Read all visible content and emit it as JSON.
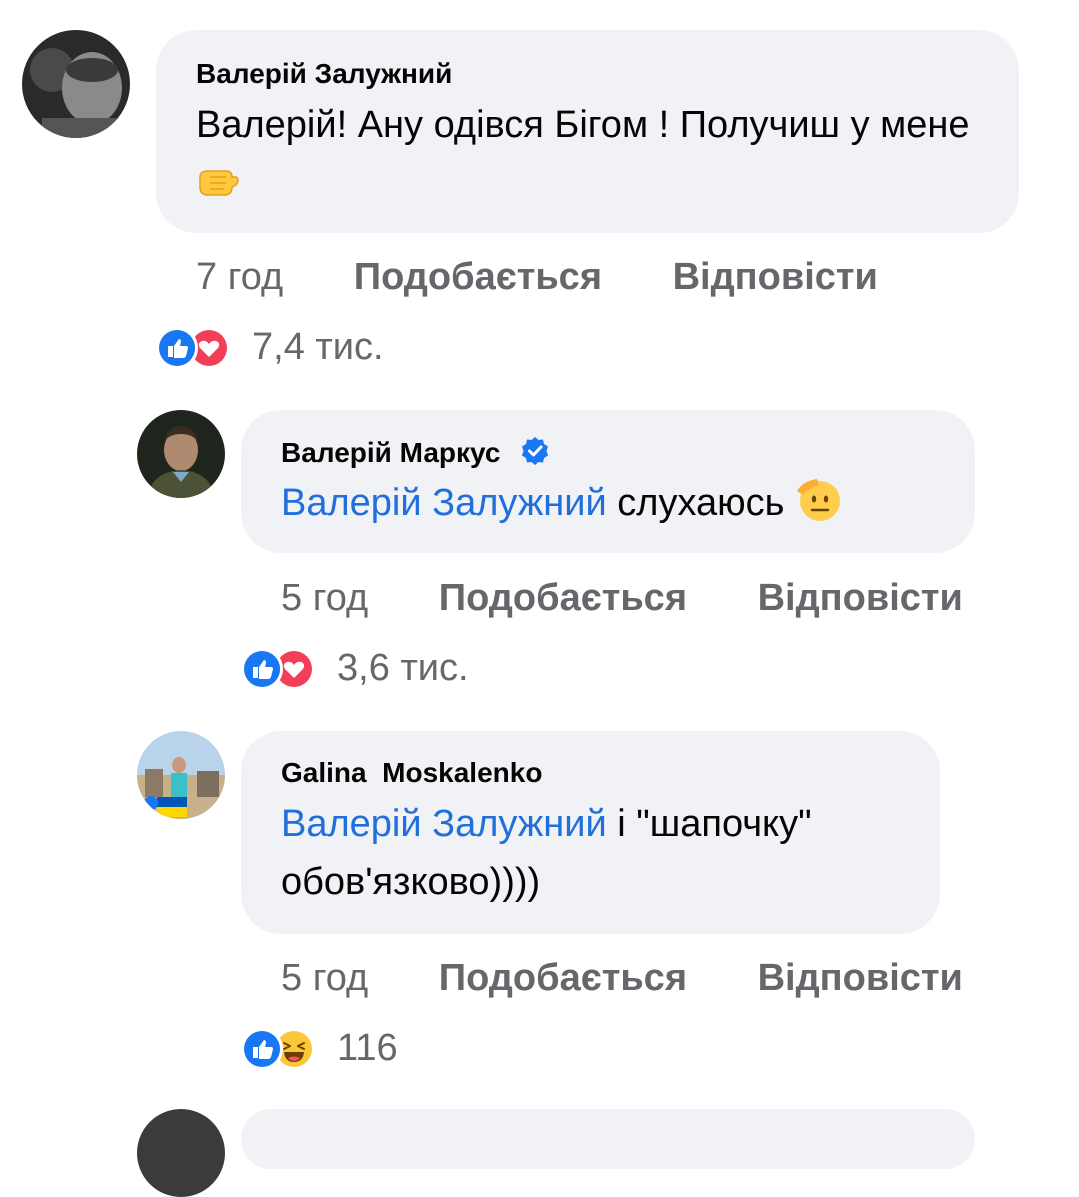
{
  "comments": [
    {
      "author": "Валерій Залужний",
      "text": "Валерій! Ану одівся Бігом ! Получиш у мене",
      "emoji": "fist-icon",
      "time": "7 год",
      "like_label": "Подобається",
      "reply_label": "Відповісти",
      "reactions": [
        "like-icon",
        "love-icon"
      ],
      "reaction_count": "7,4 тис."
    },
    {
      "author": "Валерій Маркус",
      "verified": true,
      "mention": "Валерій Залужний",
      "text": "слухаюсь",
      "emoji": "saluting-face-icon",
      "time": "5 год",
      "like_label": "Подобається",
      "reply_label": "Відповісти",
      "reactions": [
        "like-icon",
        "love-icon"
      ],
      "reaction_count": "3,6 тис."
    },
    {
      "author": "Galina  Moskalenko",
      "mention": "Валерій Залужний",
      "text_line1": " і \"шапочку\"",
      "text_line2": "обов'язково))))",
      "time": "5 год",
      "like_label": "Подобається",
      "reply_label": "Відповісти",
      "reactions": [
        "like-icon",
        "haha-icon"
      ],
      "reaction_count": "116"
    }
  ],
  "colors": {
    "bubble": "#f0f2f5",
    "mention": "#216fdb",
    "meta": "#65676b",
    "like": "#1877f2",
    "love": "#f33e58"
  }
}
